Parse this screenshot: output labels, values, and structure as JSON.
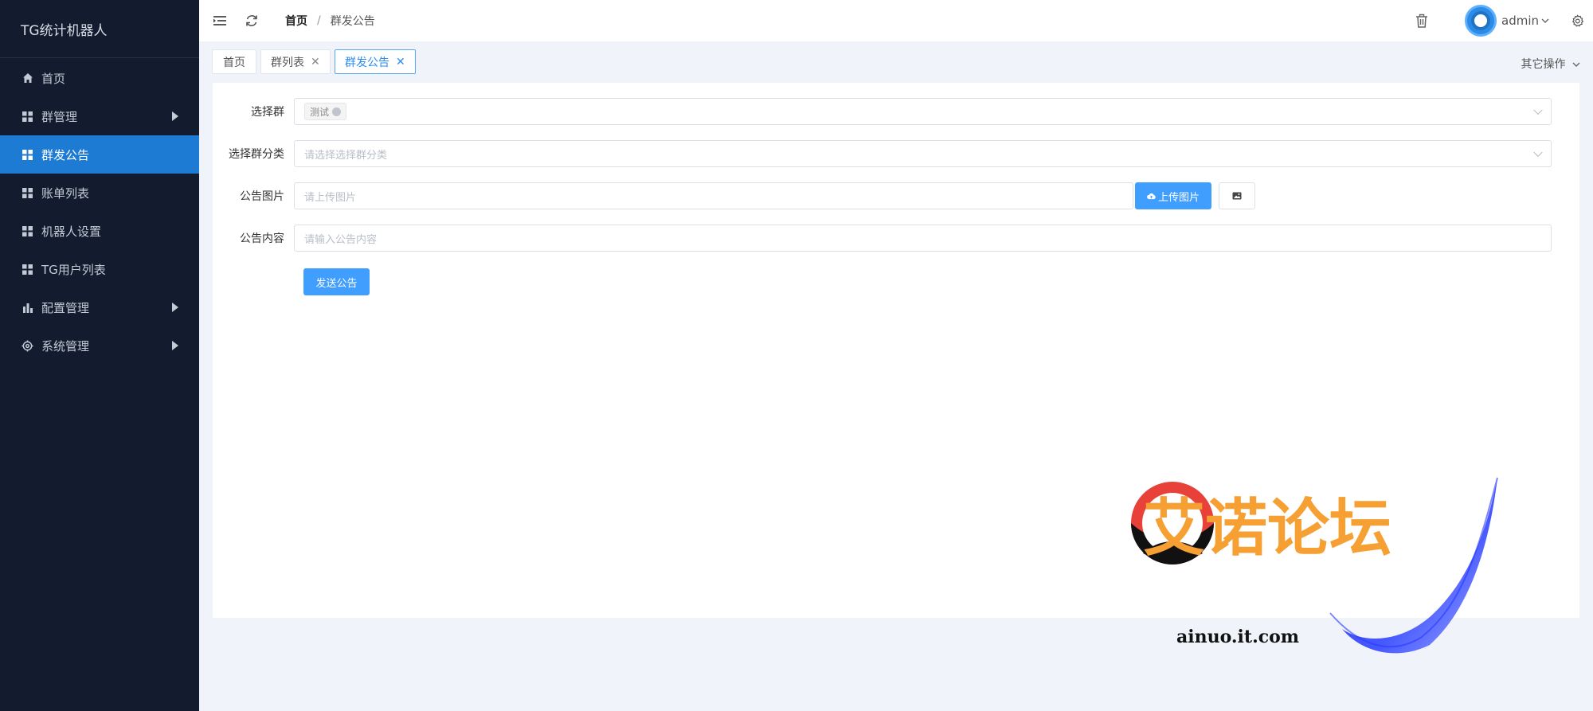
{
  "app": {
    "title": "TG统计机器人"
  },
  "sidebar": {
    "items": [
      {
        "label": "首页",
        "icon": "home-icon",
        "active": false,
        "has_children": false
      },
      {
        "label": "群管理",
        "icon": "grid-icon",
        "active": false,
        "has_children": true
      },
      {
        "label": "群发公告",
        "icon": "grid-icon",
        "active": true,
        "has_children": false
      },
      {
        "label": "账单列表",
        "icon": "grid-icon",
        "active": false,
        "has_children": false
      },
      {
        "label": "机器人设置",
        "icon": "grid-icon",
        "active": false,
        "has_children": false
      },
      {
        "label": "TG用户列表",
        "icon": "grid-icon",
        "active": false,
        "has_children": false
      },
      {
        "label": "配置管理",
        "icon": "bar-chart-icon",
        "active": false,
        "has_children": true
      },
      {
        "label": "系统管理",
        "icon": "gear-icon",
        "active": false,
        "has_children": true
      }
    ]
  },
  "header": {
    "breadcrumb": {
      "home": "首页",
      "separator": "/",
      "current": "群发公告"
    },
    "user": {
      "name": "admin"
    }
  },
  "tabs": {
    "items": [
      {
        "label": "首页",
        "closable": false,
        "active": false
      },
      {
        "label": "群列表",
        "closable": true,
        "active": false
      },
      {
        "label": "群发公告",
        "closable": true,
        "active": true
      }
    ],
    "other_ops": "其它操作"
  },
  "form": {
    "group": {
      "label": "选择群",
      "selected_tag": "测试"
    },
    "group_category": {
      "label": "选择群分类",
      "placeholder": "请选择选择群分类"
    },
    "image": {
      "label": "公告图片",
      "placeholder": "请上传图片",
      "upload_label": "上传图片"
    },
    "content": {
      "label": "公告内容",
      "placeholder": "请输入公告内容"
    },
    "submit_label": "发送公告"
  },
  "watermark": {
    "text": "艾诺论坛",
    "url": "ainuo.it.com"
  },
  "colors": {
    "sidebar_bg": "#131c2e",
    "active": "#1e7bd4",
    "primary": "#409eff"
  }
}
